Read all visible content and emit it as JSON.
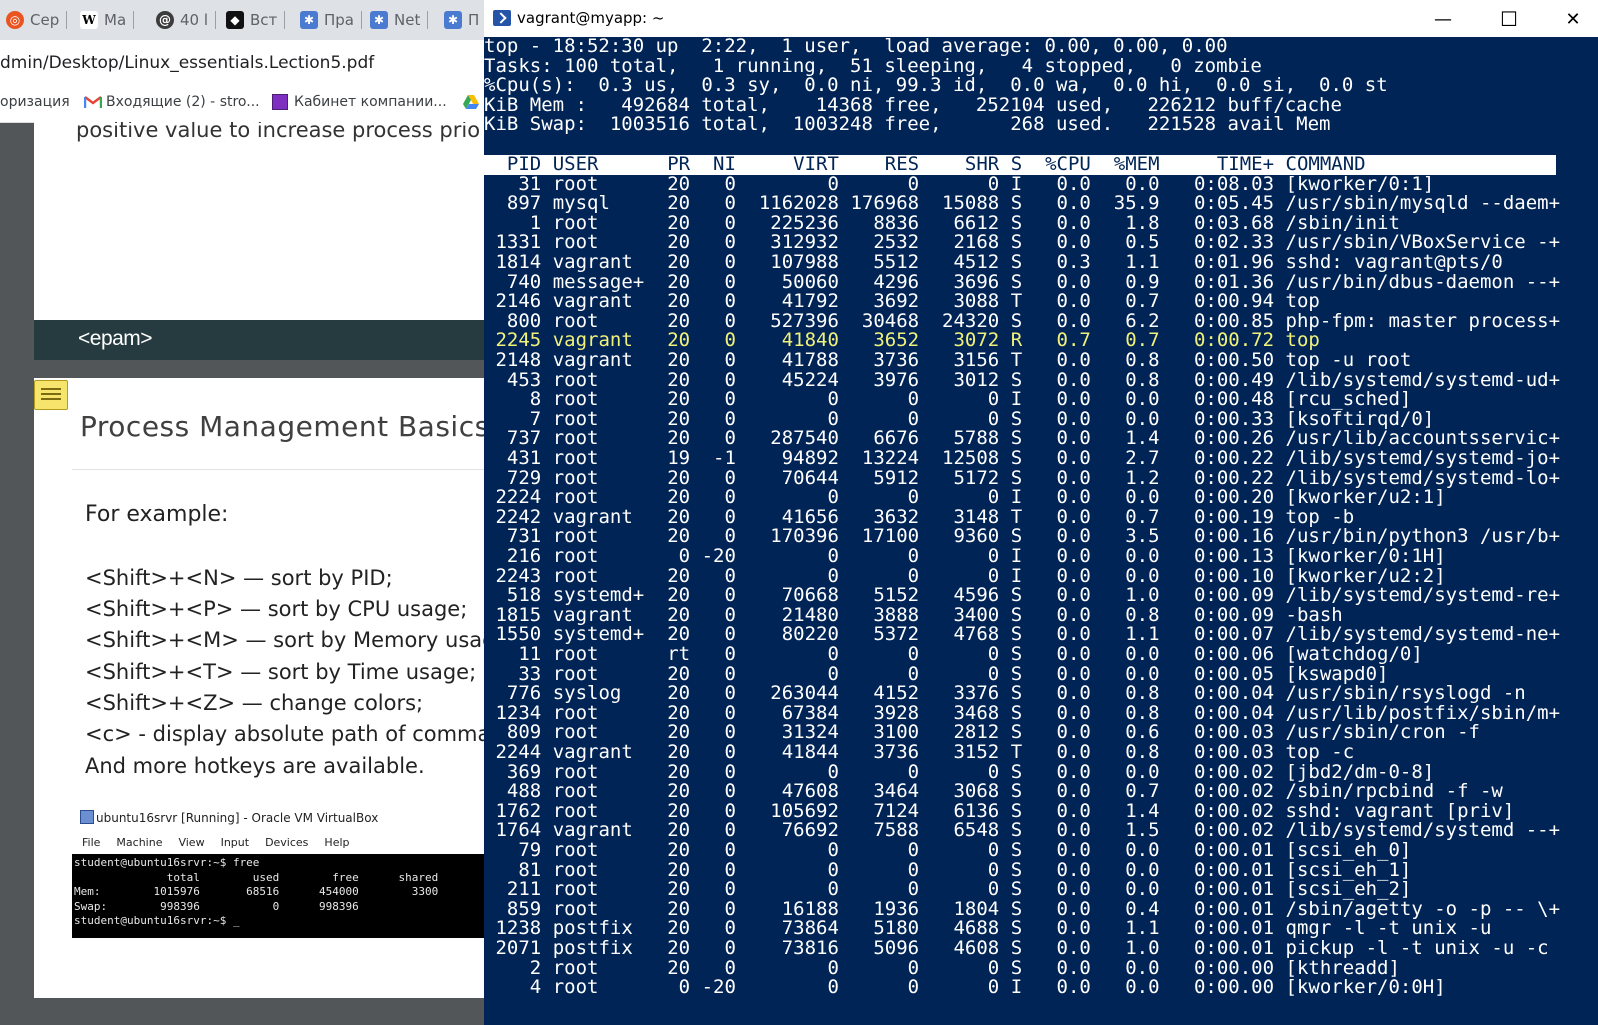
{
  "browser": {
    "tabs": [
      {
        "label": "Сер",
        "icon": "ubuntu-icon",
        "color": "#e95420"
      },
      {
        "label": "Ма",
        "icon": "wikipedia-icon",
        "color": "#ffffff"
      },
      {
        "label": "40 l",
        "icon": "spiral-icon",
        "color": "#3c3c3c"
      },
      {
        "label": "Вст",
        "icon": "dark-app-icon",
        "color": "#111111"
      },
      {
        "label": "Пра",
        "icon": "puzzle-icon",
        "color": "#4a7bd0"
      },
      {
        "label": "Net",
        "icon": "puzzle-icon",
        "color": "#4a7bd0"
      },
      {
        "label": "П",
        "icon": "puzzle-icon",
        "color": "#4a7bd0"
      }
    ],
    "address": "dmin/Desktop/Linux_essentials.Lection5.pdf",
    "bookmarks": [
      {
        "label": "оризация",
        "icon": ""
      },
      {
        "label": "Входящие (2) - stro...",
        "icon": "gmail-icon"
      },
      {
        "label": "Кабинет компании...",
        "icon": "purple-square-icon"
      },
      {
        "label": "",
        "icon": "google-drive-icon"
      }
    ]
  },
  "pdf": {
    "page1_text": "positive value to increase process prio",
    "logo": "<epam>",
    "page2": {
      "title": "Process Management Basics",
      "example_label": "For example:",
      "hotkeys": [
        "<Shift>+<N> — sort by PID;",
        "<Shift>+<P> — sort by CPU usage;",
        "<Shift>+<M> — sort by Memory usage",
        "<Shift>+<T> — sort by Time usage;",
        "<Shift>+<Z> — change colors;",
        "<c> - display absolute path of command",
        "And more hotkeys are available."
      ],
      "vbox": {
        "title": "ubuntu16srvr [Running] - Oracle VM VirtualBox",
        "menu": [
          "File",
          "Machine",
          "View",
          "Input",
          "Devices",
          "Help"
        ],
        "terminal_lines": [
          "student@ubuntu16srvr:~$ free",
          "              total        used        free      shared",
          "Mem:        1015976       68516      454000        3300",
          "Swap:        998396           0      998396",
          "student@ubuntu16srvr:~$ _"
        ]
      }
    }
  },
  "terminal": {
    "title": "vagrant@myapp: ~",
    "buttons": {
      "minimize": "—",
      "maximize": "☐",
      "close": "✕"
    },
    "summary": [
      "top - 18:52:30 up  2:22,  1 user,  load average: 0.00, 0.00, 0.00",
      "Tasks: 100 total,   1 running,  51 sleeping,   4 stopped,   0 zombie",
      "%Cpu(s):  0.3 us,  0.3 sy,  0.0 ni, 99.3 id,  0.0 wa,  0.0 hi,  0.0 si,  0.0 st",
      "KiB Mem :   492684 total,    14368 free,   252104 used,   226212 buff/cache",
      "KiB Swap:  1003516 total,  1003248 free,      268 used.   221528 avail Mem"
    ],
    "columns": [
      "PID",
      "USER",
      "PR",
      "NI",
      "VIRT",
      "RES",
      "SHR",
      "S",
      "%CPU",
      "%MEM",
      "TIME+",
      "COMMAND"
    ],
    "rows": [
      [
        "31",
        "root",
        "20",
        "0",
        "0",
        "0",
        "0",
        "I",
        "0.0",
        "0.0",
        "0:08.03",
        "[kworker/0:1]"
      ],
      [
        "897",
        "mysql",
        "20",
        "0",
        "1162028",
        "176968",
        "15088",
        "S",
        "0.0",
        "35.9",
        "0:05.45",
        "/usr/sbin/mysqld --daem+"
      ],
      [
        "1",
        "root",
        "20",
        "0",
        "225236",
        "8836",
        "6612",
        "S",
        "0.0",
        "1.8",
        "0:03.68",
        "/sbin/init"
      ],
      [
        "1331",
        "root",
        "20",
        "0",
        "312932",
        "2532",
        "2168",
        "S",
        "0.0",
        "0.5",
        "0:02.33",
        "/usr/sbin/VBoxService -+"
      ],
      [
        "1814",
        "vagrant",
        "20",
        "0",
        "107988",
        "5512",
        "4512",
        "S",
        "0.3",
        "1.1",
        "0:01.96",
        "sshd: vagrant@pts/0"
      ],
      [
        "740",
        "message+",
        "20",
        "0",
        "50060",
        "4296",
        "3696",
        "S",
        "0.0",
        "0.9",
        "0:01.36",
        "/usr/bin/dbus-daemon --+"
      ],
      [
        "2146",
        "vagrant",
        "20",
        "0",
        "41792",
        "3692",
        "3088",
        "T",
        "0.0",
        "0.7",
        "0:00.94",
        "top"
      ],
      [
        "800",
        "root",
        "20",
        "0",
        "527396",
        "30468",
        "24320",
        "S",
        "0.0",
        "6.2",
        "0:00.85",
        "php-fpm: master process+"
      ],
      [
        "2245",
        "vagrant",
        "20",
        "0",
        "41840",
        "3652",
        "3072",
        "R",
        "0.7",
        "0.7",
        "0:00.72",
        "top"
      ],
      [
        "2148",
        "vagrant",
        "20",
        "0",
        "41788",
        "3736",
        "3156",
        "T",
        "0.0",
        "0.8",
        "0:00.50",
        "top -u root"
      ],
      [
        "453",
        "root",
        "20",
        "0",
        "45224",
        "3976",
        "3012",
        "S",
        "0.0",
        "0.8",
        "0:00.49",
        "/lib/systemd/systemd-ud+"
      ],
      [
        "8",
        "root",
        "20",
        "0",
        "0",
        "0",
        "0",
        "I",
        "0.0",
        "0.0",
        "0:00.48",
        "[rcu_sched]"
      ],
      [
        "7",
        "root",
        "20",
        "0",
        "0",
        "0",
        "0",
        "S",
        "0.0",
        "0.0",
        "0:00.33",
        "[ksoftirqd/0]"
      ],
      [
        "737",
        "root",
        "20",
        "0",
        "287540",
        "6676",
        "5788",
        "S",
        "0.0",
        "1.4",
        "0:00.26",
        "/usr/lib/accountsservic+"
      ],
      [
        "431",
        "root",
        "19",
        "-1",
        "94892",
        "13224",
        "12508",
        "S",
        "0.0",
        "2.7",
        "0:00.22",
        "/lib/systemd/systemd-jo+"
      ],
      [
        "729",
        "root",
        "20",
        "0",
        "70644",
        "5912",
        "5172",
        "S",
        "0.0",
        "1.2",
        "0:00.22",
        "/lib/systemd/systemd-lo+"
      ],
      [
        "2224",
        "root",
        "20",
        "0",
        "0",
        "0",
        "0",
        "I",
        "0.0",
        "0.0",
        "0:00.20",
        "[kworker/u2:1]"
      ],
      [
        "2242",
        "vagrant",
        "20",
        "0",
        "41656",
        "3632",
        "3148",
        "T",
        "0.0",
        "0.7",
        "0:00.19",
        "top -b"
      ],
      [
        "731",
        "root",
        "20",
        "0",
        "170396",
        "17100",
        "9360",
        "S",
        "0.0",
        "3.5",
        "0:00.16",
        "/usr/bin/python3 /usr/b+"
      ],
      [
        "216",
        "root",
        "0",
        "-20",
        "0",
        "0",
        "0",
        "I",
        "0.0",
        "0.0",
        "0:00.13",
        "[kworker/0:1H]"
      ],
      [
        "2243",
        "root",
        "20",
        "0",
        "0",
        "0",
        "0",
        "I",
        "0.0",
        "0.0",
        "0:00.10",
        "[kworker/u2:2]"
      ],
      [
        "518",
        "systemd+",
        "20",
        "0",
        "70668",
        "5152",
        "4596",
        "S",
        "0.0",
        "1.0",
        "0:00.09",
        "/lib/systemd/systemd-re+"
      ],
      [
        "1815",
        "vagrant",
        "20",
        "0",
        "21480",
        "3888",
        "3400",
        "S",
        "0.0",
        "0.8",
        "0:00.09",
        "-bash"
      ],
      [
        "1550",
        "systemd+",
        "20",
        "0",
        "80220",
        "5372",
        "4768",
        "S",
        "0.0",
        "1.1",
        "0:00.07",
        "/lib/systemd/systemd-ne+"
      ],
      [
        "11",
        "root",
        "rt",
        "0",
        "0",
        "0",
        "0",
        "S",
        "0.0",
        "0.0",
        "0:00.06",
        "[watchdog/0]"
      ],
      [
        "33",
        "root",
        "20",
        "0",
        "0",
        "0",
        "0",
        "S",
        "0.0",
        "0.0",
        "0:00.05",
        "[kswapd0]"
      ],
      [
        "776",
        "syslog",
        "20",
        "0",
        "263044",
        "4152",
        "3376",
        "S",
        "0.0",
        "0.8",
        "0:00.04",
        "/usr/sbin/rsyslogd -n"
      ],
      [
        "1234",
        "root",
        "20",
        "0",
        "67384",
        "3928",
        "3468",
        "S",
        "0.0",
        "0.8",
        "0:00.04",
        "/usr/lib/postfix/sbin/m+"
      ],
      [
        "809",
        "root",
        "20",
        "0",
        "31324",
        "3100",
        "2812",
        "S",
        "0.0",
        "0.6",
        "0:00.03",
        "/usr/sbin/cron -f"
      ],
      [
        "2244",
        "vagrant",
        "20",
        "0",
        "41844",
        "3736",
        "3152",
        "T",
        "0.0",
        "0.8",
        "0:00.03",
        "top -c"
      ],
      [
        "369",
        "root",
        "20",
        "0",
        "0",
        "0",
        "0",
        "S",
        "0.0",
        "0.0",
        "0:00.02",
        "[jbd2/dm-0-8]"
      ],
      [
        "488",
        "root",
        "20",
        "0",
        "47608",
        "3464",
        "3068",
        "S",
        "0.0",
        "0.7",
        "0:00.02",
        "/sbin/rpcbind -f -w"
      ],
      [
        "1762",
        "root",
        "20",
        "0",
        "105692",
        "7124",
        "6136",
        "S",
        "0.0",
        "1.4",
        "0:00.02",
        "sshd: vagrant [priv]"
      ],
      [
        "1764",
        "vagrant",
        "20",
        "0",
        "76692",
        "7588",
        "6548",
        "S",
        "0.0",
        "1.5",
        "0:00.02",
        "/lib/systemd/systemd --+"
      ],
      [
        "79",
        "root",
        "20",
        "0",
        "0",
        "0",
        "0",
        "S",
        "0.0",
        "0.0",
        "0:00.01",
        "[scsi_eh_0]"
      ],
      [
        "81",
        "root",
        "20",
        "0",
        "0",
        "0",
        "0",
        "S",
        "0.0",
        "0.0",
        "0:00.01",
        "[scsi_eh_1]"
      ],
      [
        "211",
        "root",
        "20",
        "0",
        "0",
        "0",
        "0",
        "S",
        "0.0",
        "0.0",
        "0:00.01",
        "[scsi_eh_2]"
      ],
      [
        "859",
        "root",
        "20",
        "0",
        "16188",
        "1936",
        "1804",
        "S",
        "0.0",
        "0.4",
        "0:00.01",
        "/sbin/agetty -o -p -- \\+"
      ],
      [
        "1238",
        "postfix",
        "20",
        "0",
        "73864",
        "5180",
        "4688",
        "S",
        "0.0",
        "1.1",
        "0:00.01",
        "qmgr -l -t unix -u"
      ],
      [
        "2071",
        "postfix",
        "20",
        "0",
        "73816",
        "5096",
        "4608",
        "S",
        "0.0",
        "1.0",
        "0:00.01",
        "pickup -l -t unix -u -c"
      ],
      [
        "2",
        "root",
        "20",
        "0",
        "0",
        "0",
        "0",
        "S",
        "0.0",
        "0.0",
        "0:00.00",
        "[kthreadd]"
      ],
      [
        "4",
        "root",
        "0",
        "-20",
        "0",
        "0",
        "0",
        "I",
        "0.0",
        "0.0",
        "0:00.00",
        "[kworker/0:0H]"
      ]
    ],
    "highlight_pid": "2245",
    "colors": {
      "background": "#012456",
      "foreground": "#ffffff",
      "highlight": "#f2f27a",
      "header_bg": "#ffffff"
    }
  }
}
